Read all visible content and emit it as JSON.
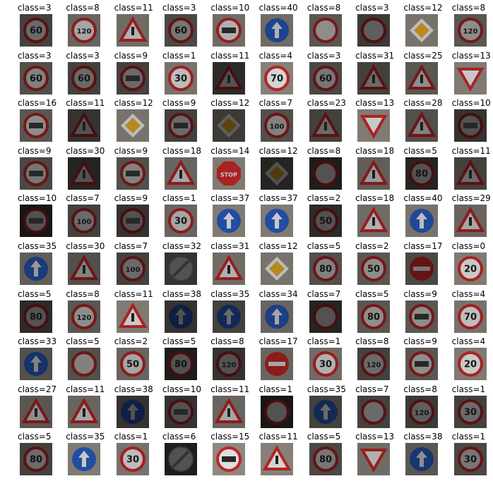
{
  "grid": {
    "rows": 10,
    "cols": 10,
    "labels": [
      "class=3",
      "class=8",
      "class=11",
      "class=3",
      "class=10",
      "class=40",
      "class=8",
      "class=3",
      "class=12",
      "class=8",
      "class=3",
      "class=3",
      "class=9",
      "class=1",
      "class=11",
      "class=4",
      "class=3",
      "class=31",
      "class=25",
      "class=13",
      "class=16",
      "class=11",
      "class=12",
      "class=9",
      "class=12",
      "class=7",
      "class=23",
      "class=13",
      "class=28",
      "class=10",
      "class=9",
      "class=30",
      "class=9",
      "class=18",
      "class=14",
      "class=12",
      "class=8",
      "class=18",
      "class=5",
      "class=11",
      "class=10",
      "class=7",
      "class=9",
      "class=1",
      "class=37",
      "class=37",
      "class=2",
      "class=18",
      "class=40",
      "class=29",
      "class=35",
      "class=30",
      "class=7",
      "class=32",
      "class=31",
      "class=12",
      "class=5",
      "class=2",
      "class=17",
      "class=0",
      "class=5",
      "class=8",
      "class=11",
      "class=38",
      "class=35",
      "class=34",
      "class=7",
      "class=5",
      "class=9",
      "class=4",
      "class=33",
      "class=5",
      "class=2",
      "class=5",
      "class=8",
      "class=17",
      "class=1",
      "class=8",
      "class=9",
      "class=4",
      "class=27",
      "class=11",
      "class=38",
      "class=10",
      "class=11",
      "class=1",
      "class=35",
      "class=7",
      "class=8",
      "class=1",
      "class=5",
      "class=35",
      "class=1",
      "class=6",
      "class=15",
      "class=11",
      "class=5",
      "class=13",
      "class=38",
      "class=1"
    ],
    "signs": [
      "60",
      "120",
      "",
      "60",
      "",
      "",
      "",
      "",
      "",
      "120",
      "60",
      "60",
      "",
      "30",
      "",
      "70",
      "60",
      "",
      "",
      "",
      "",
      "",
      "",
      "",
      "",
      "100",
      "",
      "",
      "",
      "",
      "",
      "",
      "",
      "",
      "STOP",
      "",
      "",
      "",
      "80",
      "",
      "",
      "100",
      "",
      "30",
      "",
      "",
      "50",
      "",
      "",
      "",
      "",
      "",
      "100",
      "",
      "",
      "",
      "80",
      "50",
      "",
      "20",
      "80",
      "120",
      "",
      "",
      "",
      "",
      "",
      "80",
      "",
      "70",
      "",
      "",
      "50",
      "80",
      "120",
      "",
      "30",
      "120",
      "",
      "20",
      "",
      "",
      "",
      "",
      "",
      "",
      "",
      "",
      "120",
      "30",
      "80",
      "",
      "30",
      "",
      "",
      "",
      "80",
      "",
      "",
      "30"
    ],
    "classes": [
      3,
      8,
      11,
      3,
      10,
      40,
      8,
      3,
      12,
      8,
      3,
      3,
      9,
      1,
      11,
      4,
      3,
      31,
      25,
      13,
      16,
      11,
      12,
      9,
      12,
      7,
      23,
      13,
      28,
      10,
      9,
      30,
      9,
      18,
      14,
      12,
      8,
      18,
      5,
      11,
      10,
      7,
      9,
      1,
      37,
      37,
      2,
      18,
      40,
      29,
      35,
      30,
      7,
      32,
      31,
      12,
      5,
      2,
      17,
      0,
      5,
      8,
      11,
      38,
      35,
      34,
      7,
      5,
      9,
      4,
      33,
      5,
      2,
      5,
      8,
      17,
      1,
      8,
      9,
      4,
      27,
      11,
      38,
      10,
      11,
      1,
      35,
      7,
      8,
      1,
      5,
      35,
      1,
      6,
      15,
      11,
      5,
      13,
      38,
      1
    ],
    "brightness": [
      0.45,
      0.7,
      0.75,
      0.5,
      0.75,
      0.75,
      0.6,
      0.4,
      0.8,
      0.6,
      0.55,
      0.45,
      0.45,
      0.8,
      0.3,
      0.9,
      0.5,
      0.45,
      0.6,
      0.85,
      0.6,
      0.35,
      0.8,
      0.45,
      0.4,
      0.55,
      0.45,
      0.85,
      0.55,
      0.35,
      0.5,
      0.25,
      0.55,
      0.7,
      0.85,
      0.25,
      0.2,
      0.65,
      0.25,
      0.45,
      0.15,
      0.45,
      0.35,
      0.7,
      0.85,
      0.85,
      0.3,
      0.75,
      0.8,
      0.7,
      0.65,
      0.55,
      0.45,
      0.35,
      0.75,
      0.8,
      0.55,
      0.6,
      0.5,
      0.85,
      0.3,
      0.6,
      0.85,
      0.35,
      0.45,
      0.7,
      0.25,
      0.6,
      0.6,
      0.8,
      0.55,
      0.55,
      0.7,
      0.2,
      0.35,
      0.7,
      0.75,
      0.45,
      0.6,
      0.85,
      0.6,
      0.7,
      0.35,
      0.35,
      0.7,
      0.15,
      0.45,
      0.45,
      0.4,
      0.45,
      0.45,
      0.85,
      0.8,
      0.2,
      0.95,
      0.9,
      0.5,
      0.75,
      0.6,
      0.5
    ]
  }
}
